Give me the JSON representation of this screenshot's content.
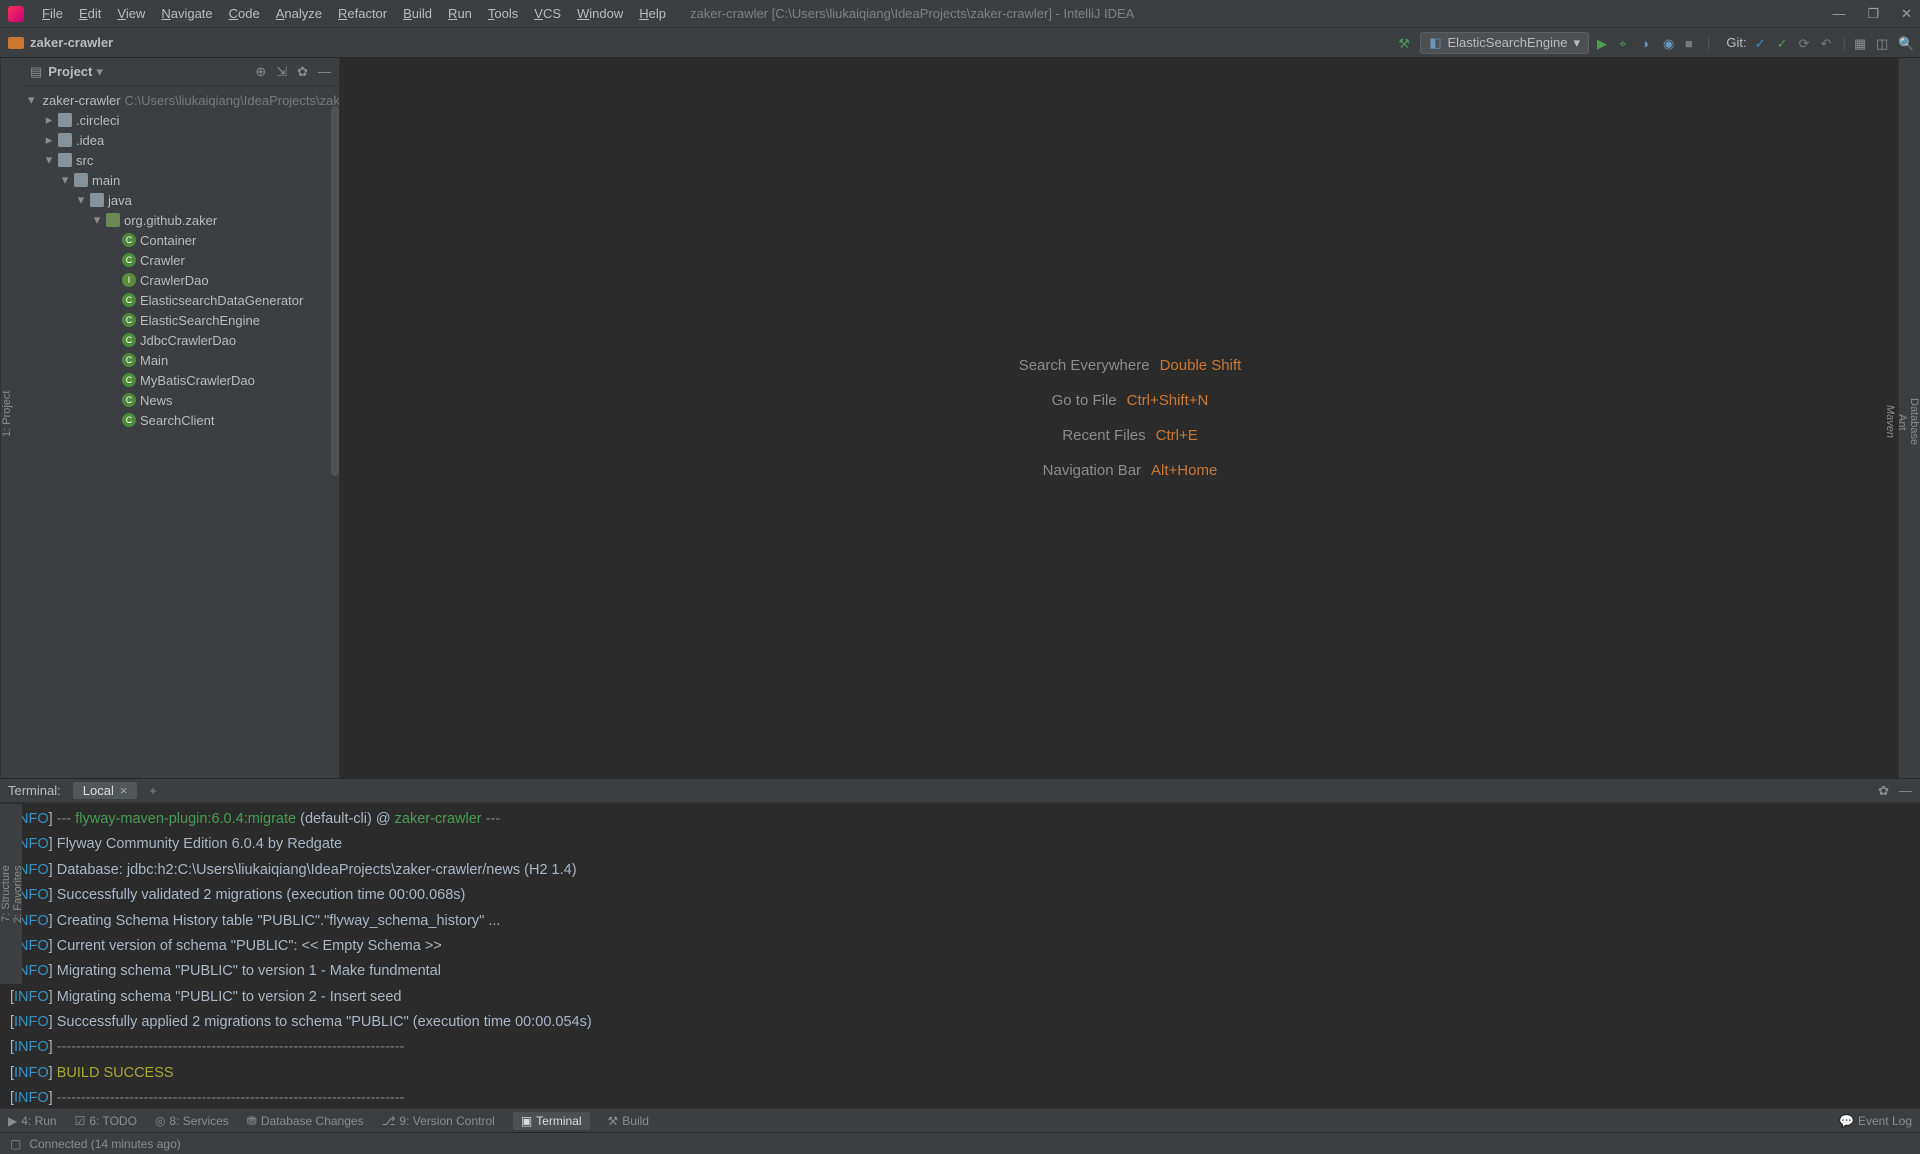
{
  "titlebar": {
    "menus": [
      "File",
      "Edit",
      "View",
      "Navigate",
      "Code",
      "Analyze",
      "Refactor",
      "Build",
      "Run",
      "Tools",
      "VCS",
      "Window",
      "Help"
    ],
    "title": "zaker-crawler [C:\\Users\\liukaiqiang\\IdeaProjects\\zaker-crawler] - IntelliJ IDEA"
  },
  "navbar": {
    "breadcrumb": "zaker-crawler",
    "run_config": "ElasticSearchEngine",
    "git_label": "Git:"
  },
  "project": {
    "title": "Project",
    "root": {
      "name": "zaker-crawler",
      "path": "C:\\Users\\liukaiqiang\\IdeaProjects\\zaker-crawler"
    },
    "folders": [
      ".circleci",
      ".idea"
    ],
    "src": "src",
    "main": "main",
    "java": "java",
    "pkg": "org.github.zaker",
    "classes": [
      "Container",
      "Crawler",
      "CrawlerDao",
      "ElasticsearchDataGenerator",
      "ElasticSearchEngine",
      "JdbcCrawlerDao",
      "Main",
      "MyBatisCrawlerDao",
      "News",
      "SearchClient"
    ]
  },
  "editor_hints": [
    {
      "label": "Search Everywhere",
      "shortcut": "Double Shift"
    },
    {
      "label": "Go to File",
      "shortcut": "Ctrl+Shift+N"
    },
    {
      "label": "Recent Files",
      "shortcut": "Ctrl+E"
    },
    {
      "label": "Navigation Bar",
      "shortcut": "Alt+Home"
    }
  ],
  "terminal": {
    "label": "Terminal:",
    "tab": "Local",
    "lines": [
      {
        "type": "plugin",
        "text": "--- flyway-maven-plugin:6.0.4:migrate (default-cli) @ zaker-crawler ---"
      },
      {
        "type": "plain",
        "text": "Flyway Community Edition 6.0.4 by Redgate"
      },
      {
        "type": "plain",
        "text": "Database: jdbc:h2:C:\\Users\\liukaiqiang\\IdeaProjects\\zaker-crawler/news (H2 1.4)"
      },
      {
        "type": "plain",
        "text": "Successfully validated 2 migrations (execution time 00:00.068s)"
      },
      {
        "type": "plain",
        "text": "Creating Schema History table \"PUBLIC\".\"flyway_schema_history\" ..."
      },
      {
        "type": "plain",
        "text": "Current version of schema \"PUBLIC\": << Empty Schema >>"
      },
      {
        "type": "plain",
        "text": "Migrating schema \"PUBLIC\" to version 1 - Make fundmental"
      },
      {
        "type": "plain",
        "text": "Migrating schema \"PUBLIC\" to version 2 - Insert seed"
      },
      {
        "type": "plain",
        "text": "Successfully applied 2 migrations to schema \"PUBLIC\" (execution time 00:00.054s)"
      },
      {
        "type": "dash",
        "text": "------------------------------------------------------------------------"
      },
      {
        "type": "success",
        "text": "BUILD SUCCESS"
      },
      {
        "type": "dash",
        "text": "------------------------------------------------------------------------"
      }
    ]
  },
  "status_tabs": {
    "run": "4: Run",
    "todo": "6: TODO",
    "services": "8: Services",
    "db_changes": "Database Changes",
    "vcs": "9: Version Control",
    "terminal": "Terminal",
    "build": "Build",
    "event_log": "Event Log"
  },
  "statusbar": {
    "msg": "Connected (14 minutes ago)"
  },
  "right_tools": [
    "Database",
    "Ant",
    "Maven"
  ],
  "left_tools": [
    "1: Project"
  ],
  "left_tools2": [
    "7: Structure",
    "2: Favorites"
  ]
}
